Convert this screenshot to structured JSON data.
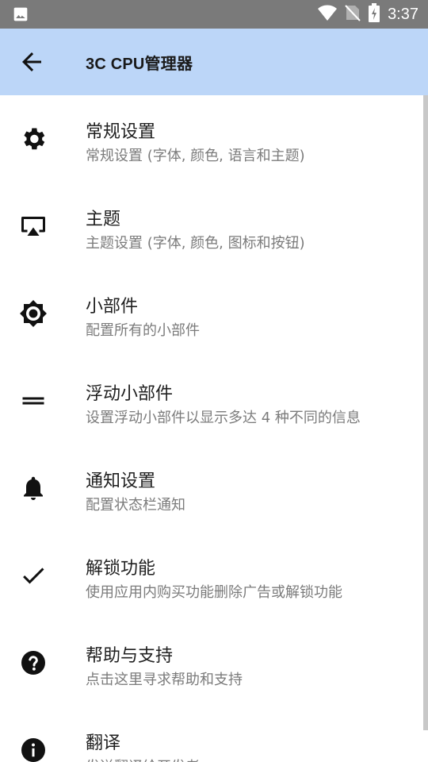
{
  "status_bar": {
    "time": "3:37",
    "icons": [
      "image-icon",
      "wifi-icon",
      "no-sim-icon",
      "battery-charging-icon"
    ]
  },
  "app_bar": {
    "title": "3C CPU管理器",
    "back_icon": "arrow-back-icon"
  },
  "items": [
    {
      "icon": "gear-icon",
      "title": "常规设置",
      "subtitle": "常规设置 (字体, 颜色, 语言和主题)"
    },
    {
      "icon": "cast-icon",
      "title": "主题",
      "subtitle": "主题设置 (字体, 颜色, 图标和按钮)"
    },
    {
      "icon": "brightness-icon",
      "title": "小部件",
      "subtitle": "配置所有的小部件"
    },
    {
      "icon": "equals-icon",
      "title": "浮动小部件",
      "subtitle": "设置浮动小部件以显示多达 4 种不同的信息"
    },
    {
      "icon": "bell-icon",
      "title": "通知设置",
      "subtitle": "配置状态栏通知"
    },
    {
      "icon": "check-icon",
      "title": "解锁功能",
      "subtitle": "使用应用内购买功能删除广告或解锁功能"
    },
    {
      "icon": "help-icon",
      "title": "帮助与支持",
      "subtitle": "点击这里寻求帮助和支持"
    },
    {
      "icon": "info-icon",
      "title": "翻译",
      "subtitle": "发送翻译给开发者"
    }
  ],
  "colors": {
    "app_bar": "#bcd6f8",
    "status_bar": "#7a7a7a",
    "title_text": "#202020",
    "subtitle_text": "#7b7b7b"
  }
}
